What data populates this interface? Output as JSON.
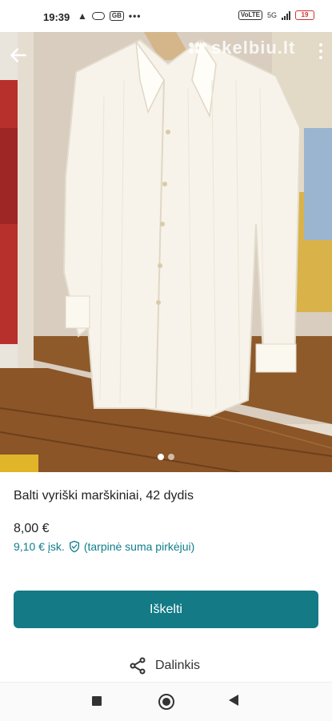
{
  "status_bar": {
    "time": "19:39",
    "data_badge": "GB",
    "left_dots": "•••",
    "network_badge": "VoLTE",
    "network_type": "5G",
    "battery_level": "19",
    "battery_color": "#d0312d"
  },
  "photo": {
    "watermark": "skelbiu.lt",
    "page_count": 2,
    "current_page": 1
  },
  "listing": {
    "title": "Balti vyriški marškiniai, 42 dydis",
    "price": "8,00 €",
    "buyer_price": "9,10 € įsk.",
    "buyer_note": "(tarpinė suma pirkėjui)"
  },
  "actions": {
    "promote_label": "Iškelti",
    "share_label": "Dalinkis"
  },
  "colors": {
    "accent": "#137a86",
    "buyer_text": "#0f7d8a"
  },
  "icons": {
    "back": "arrow-left-icon",
    "menu": "more-vertical-icon",
    "shield": "shield-check-icon",
    "share": "share-icon",
    "nav_recent": "square-icon",
    "nav_home": "circle-icon",
    "nav_back": "triangle-back-icon"
  }
}
